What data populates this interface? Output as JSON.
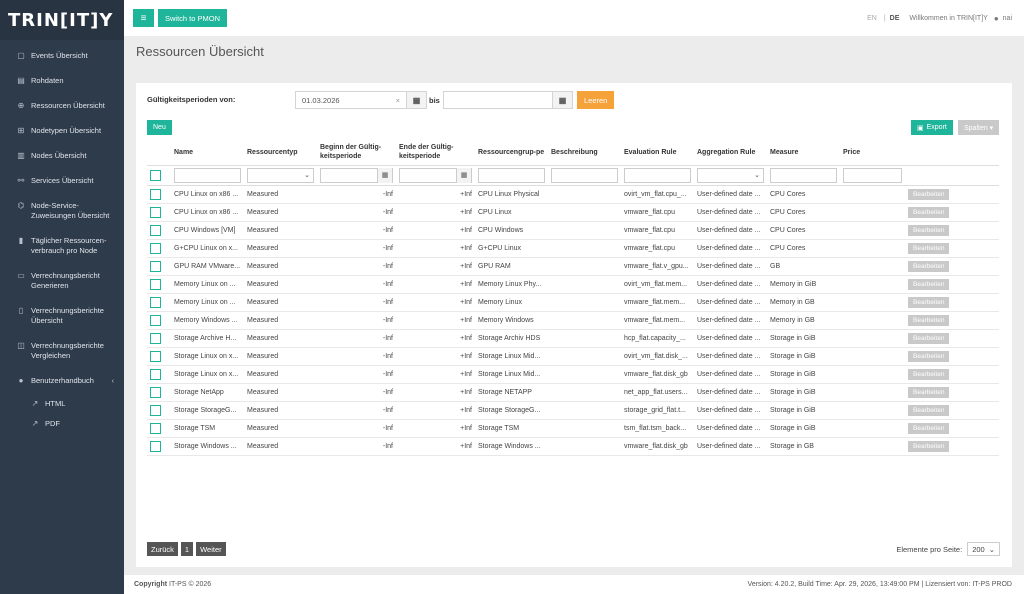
{
  "brand": "TRIN[IT]Y",
  "topbar": {
    "switch_label": "Switch to PMON",
    "lang_en": "EN",
    "lang_sep": "|",
    "lang_de": "DE",
    "welcome": "Willkommen in TRIN[IT]Y",
    "user": "nai"
  },
  "sidebar": {
    "items": [
      {
        "icon": "calendar-icon",
        "label": "Events Übersicht"
      },
      {
        "icon": "table-icon",
        "label": "Rohdaten"
      },
      {
        "icon": "globe-icon",
        "label": "Ressourcen Übersicht"
      },
      {
        "icon": "sitemap-icon",
        "label": "Nodetypen Übersicht"
      },
      {
        "icon": "server-icon",
        "label": "Nodes Übersicht"
      },
      {
        "icon": "share-icon",
        "label": "Services Übersicht"
      },
      {
        "icon": "nodes-icon",
        "label": "Node-Service-Zuweisungen Übersicht"
      },
      {
        "icon": "bar-chart-icon",
        "label": "Täglicher Ressourcen-verbrauch pro Node"
      },
      {
        "icon": "file-icon",
        "label": "Verrechnungsbericht Generieren"
      },
      {
        "icon": "document-icon",
        "label": "Verrechnungsberichte Übersicht"
      },
      {
        "icon": "compare-icon",
        "label": "Verrechnungsberichte Vergleichen"
      },
      {
        "icon": "question-icon",
        "label": "Benutzerhandbuch"
      }
    ],
    "sub_items": [
      {
        "icon": "external-link-icon",
        "label": "HTML"
      },
      {
        "icon": "external-link-icon",
        "label": "PDF"
      }
    ]
  },
  "page_title": "Ressourcen Übersicht",
  "filter": {
    "label": "Gültigkeitsperioden von:",
    "from_value": "01.03.2026",
    "clear_x": "×",
    "bis_label": "bis",
    "to_value": "",
    "clear_label": "Leeren"
  },
  "toolbar": {
    "new_label": "Neu",
    "export_label": "Export",
    "columns_label": "Spalten ▾"
  },
  "table": {
    "headers": [
      "Name",
      "Ressourcentyp",
      "Beginn der Gültig-keitsperiode",
      "Ende der Gültig-keitsperiode",
      "Ressourcengrup-pe",
      "Beschreibung",
      "Evaluation Rule",
      "Aggregation Rule",
      "Measure",
      "Price"
    ],
    "edit_label": "Bearbeiten",
    "rows": [
      {
        "name": "CPU Linux on x86 ...",
        "type": "Measured",
        "begin": "-Inf",
        "end": "+Inf",
        "group": "CPU Linux Physical",
        "desc": "",
        "eval": "ovirt_vm_flat.cpu_...",
        "agg": "User-defined date ...",
        "measure": "CPU Cores",
        "price": ""
      },
      {
        "name": "CPU Linux on x86 ...",
        "type": "Measured",
        "begin": "-Inf",
        "end": "+Inf",
        "group": "CPU Linux",
        "desc": "",
        "eval": "vmware_flat.cpu",
        "agg": "User-defined date ...",
        "measure": "CPU Cores",
        "price": ""
      },
      {
        "name": "CPU Windows [VM]",
        "type": "Measured",
        "begin": "-Inf",
        "end": "+Inf",
        "group": "CPU Windows",
        "desc": "",
        "eval": "vmware_flat.cpu",
        "agg": "User-defined date ...",
        "measure": "CPU Cores",
        "price": ""
      },
      {
        "name": "G+CPU Linux on x...",
        "type": "Measured",
        "begin": "-Inf",
        "end": "+Inf",
        "group": "G+CPU Linux",
        "desc": "",
        "eval": "vmware_flat.cpu",
        "agg": "User-defined date ...",
        "measure": "CPU Cores",
        "price": ""
      },
      {
        "name": "GPU RAM VMware...",
        "type": "Measured",
        "begin": "-Inf",
        "end": "+Inf",
        "group": "GPU RAM",
        "desc": "",
        "eval": "vmware_flat.v_gpu...",
        "agg": "User-defined date ...",
        "measure": "GB",
        "price": ""
      },
      {
        "name": "Memory Linux on ...",
        "type": "Measured",
        "begin": "-Inf",
        "end": "+Inf",
        "group": "Memory Linux Phy...",
        "desc": "",
        "eval": "ovirt_vm_flat.mem...",
        "agg": "User-defined date ...",
        "measure": "Memory in GiB",
        "price": ""
      },
      {
        "name": "Memory Linux on ...",
        "type": "Measured",
        "begin": "-Inf",
        "end": "+Inf",
        "group": "Memory Linux",
        "desc": "",
        "eval": "vmware_flat.mem...",
        "agg": "User-defined date ...",
        "measure": "Memory in GB",
        "price": ""
      },
      {
        "name": "Memory Windows ...",
        "type": "Measured",
        "begin": "-Inf",
        "end": "+Inf",
        "group": "Memory Windows",
        "desc": "",
        "eval": "vmware_flat.mem...",
        "agg": "User-defined date ...",
        "measure": "Memory in GB",
        "price": ""
      },
      {
        "name": "Storage Archive H...",
        "type": "Measured",
        "begin": "-Inf",
        "end": "+Inf",
        "group": "Storage Archiv HDS",
        "desc": "",
        "eval": "hcp_flat.capacity_...",
        "agg": "User-defined date ...",
        "measure": "Storage in GiB",
        "price": ""
      },
      {
        "name": "Storage Linux on x...",
        "type": "Measured",
        "begin": "-Inf",
        "end": "+Inf",
        "group": "Storage Linux Mid...",
        "desc": "",
        "eval": "ovirt_vm_flat.disk_...",
        "agg": "User-defined date ...",
        "measure": "Storage in GiB",
        "price": ""
      },
      {
        "name": "Storage Linux on x...",
        "type": "Measured",
        "begin": "-Inf",
        "end": "+Inf",
        "group": "Storage Linux Mid...",
        "desc": "",
        "eval": "vmware_flat.disk_gb",
        "agg": "User-defined date ...",
        "measure": "Storage in GiB",
        "price": ""
      },
      {
        "name": "Storage NetApp",
        "type": "Measured",
        "begin": "-Inf",
        "end": "+Inf",
        "group": "Storage NETAPP",
        "desc": "",
        "eval": "net_app_flat.users...",
        "agg": "User-defined date ...",
        "measure": "Storage in GiB",
        "price": ""
      },
      {
        "name": "Storage StorageG...",
        "type": "Measured",
        "begin": "-Inf",
        "end": "+Inf",
        "group": "Storage StorageG...",
        "desc": "",
        "eval": "storage_grid_flat.t...",
        "agg": "User-defined date ...",
        "measure": "Storage in GiB",
        "price": ""
      },
      {
        "name": "Storage TSM",
        "type": "Measured",
        "begin": "-Inf",
        "end": "+Inf",
        "group": "Storage TSM",
        "desc": "",
        "eval": "tsm_flat.tsm_back...",
        "agg": "User-defined date ...",
        "measure": "Storage in GiB",
        "price": ""
      },
      {
        "name": "Storage Windows ...",
        "type": "Measured",
        "begin": "-Inf",
        "end": "+Inf",
        "group": "Storage Windows ...",
        "desc": "",
        "eval": "vmware_flat.disk_gb",
        "agg": "User-defined date ...",
        "measure": "Storage in GB",
        "price": ""
      }
    ]
  },
  "pagination": {
    "prev_label": "Zurück",
    "page": "1",
    "next_label": "Weiter",
    "per_page_label": "Elemente pro Seite:",
    "per_page_value": "200"
  },
  "footer": {
    "copyright_bold": "Copyright",
    "copyright_rest": "IT-PS © 2026",
    "version": "Version: 4.20.2, Build Time: Apr. 29, 2026, 13:49:00 PM | Lizensiert von: IT-PS PROD"
  },
  "colors": {
    "sidebar": "#2e3b4a",
    "accent": "#1fb59a",
    "clear_button": "#f6a23a",
    "disabled": "#c9c9c9"
  }
}
